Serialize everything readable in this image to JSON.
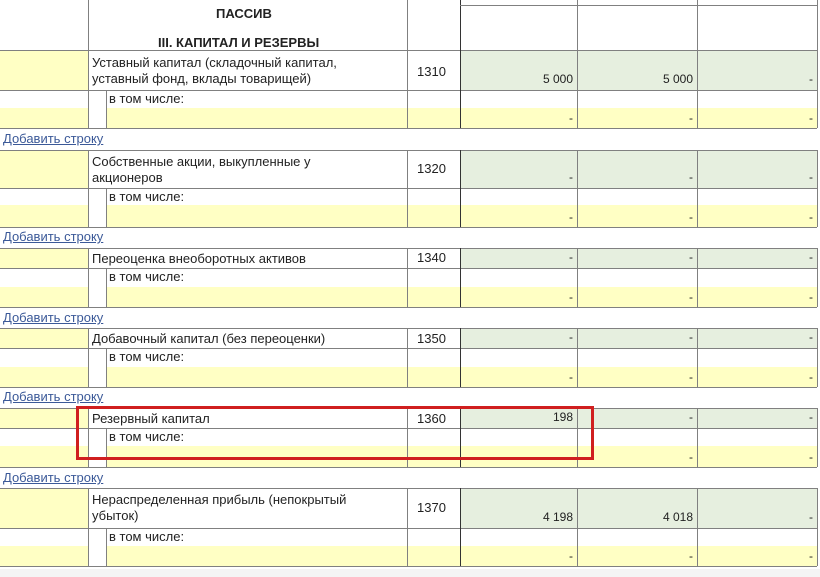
{
  "header": {
    "section_title": "ПАССИВ",
    "subsection_title": "III. КАПИТАЛ И РЕЗЕРВЫ"
  },
  "sublabel": "в том числе:",
  "add_row_label": "Добавить строку",
  "groups": [
    {
      "label": "Уставный капитал (складочный капитал, уставный фонд, вклады товарищей)",
      "label_lines": [
        "Уставный капитал (складочный капитал,",
        "уставный фонд, вклады товарищей)"
      ],
      "code": "1310",
      "values": [
        "5 000",
        "5 000",
        "-"
      ],
      "sub_values": [
        "-",
        "-",
        "-"
      ]
    },
    {
      "label": "Собственные акции, выкупленные у акционеров",
      "label_lines": [
        "Собственные акции, выкупленные у",
        "акционеров"
      ],
      "code": "1320",
      "values": [
        "-",
        "-",
        "-"
      ],
      "sub_values": [
        "-",
        "-",
        "-"
      ]
    },
    {
      "label": "Переоценка внеоборотных активов",
      "label_lines": [
        "Переоценка внеоборотных активов"
      ],
      "code": "1340",
      "values": [
        "-",
        "-",
        "-"
      ],
      "sub_values": [
        "-",
        "-",
        "-"
      ]
    },
    {
      "label": "Добавочный капитал (без переоценки)",
      "label_lines": [
        "Добавочный капитал (без переоценки)"
      ],
      "code": "1350",
      "values": [
        "-",
        "-",
        "-"
      ],
      "sub_values": [
        "-",
        "-",
        "-"
      ]
    },
    {
      "label": "Резервный капитал",
      "label_lines": [
        "Резервный капитал"
      ],
      "code": "1360",
      "values": [
        "198",
        "-",
        "-"
      ],
      "sub_values": [
        "-",
        "-",
        "-"
      ],
      "highlighted": true
    },
    {
      "label": "Нераспределенная прибыль (непокрытый убыток)",
      "label_lines": [
        "Нераспределенная прибыль (непокрытый",
        "убыток)"
      ],
      "code": "1370",
      "values": [
        "4 198",
        "4 018",
        "-"
      ],
      "sub_values": [
        "-",
        "-",
        "-"
      ]
    }
  ],
  "colors": {
    "input_yellow": "#ffffc4",
    "value_green": "#e6efdf",
    "highlight_red": "#d01f1f",
    "link_blue": "#3b5998"
  }
}
